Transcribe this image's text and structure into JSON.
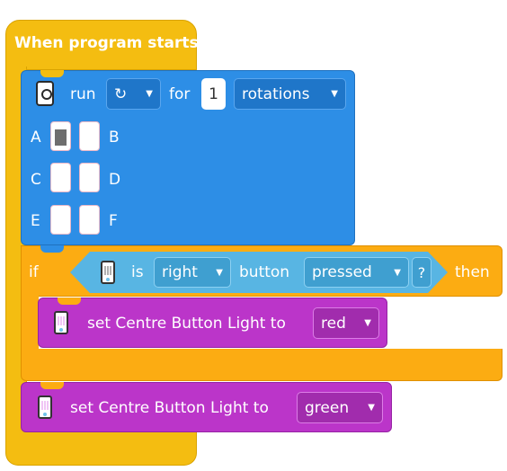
{
  "event": {
    "title": "When program starts"
  },
  "motor_block": {
    "icon": "motor-icon",
    "run_label": "run",
    "direction_icon": "rotate-clockwise-icon",
    "for_label": "for",
    "amount": "1",
    "unit": "rotations",
    "ports": [
      {
        "label": "A",
        "selected": true
      },
      {
        "label": "B",
        "selected": false
      },
      {
        "label": "C",
        "selected": false
      },
      {
        "label": "D",
        "selected": false
      },
      {
        "label": "E",
        "selected": false
      },
      {
        "label": "F",
        "selected": false
      }
    ]
  },
  "if_block": {
    "if_label": "if",
    "then_label": "then",
    "condition": {
      "icon": "hub-icon",
      "is_label": "is",
      "side": "right",
      "button_label": "button",
      "state": "pressed",
      "question": "?"
    },
    "inner": {
      "icon": "hub-light-icon",
      "text": "set Centre Button Light to",
      "color": "red"
    }
  },
  "final_block": {
    "icon": "hub-light-icon",
    "text": "set Centre Button Light to",
    "color": "green"
  },
  "colors": {
    "events": "#f4bd11",
    "motors": "#2d8ee6",
    "control": "#fcac12",
    "sensors": "#58b5e3",
    "light": "#bb35c9"
  }
}
